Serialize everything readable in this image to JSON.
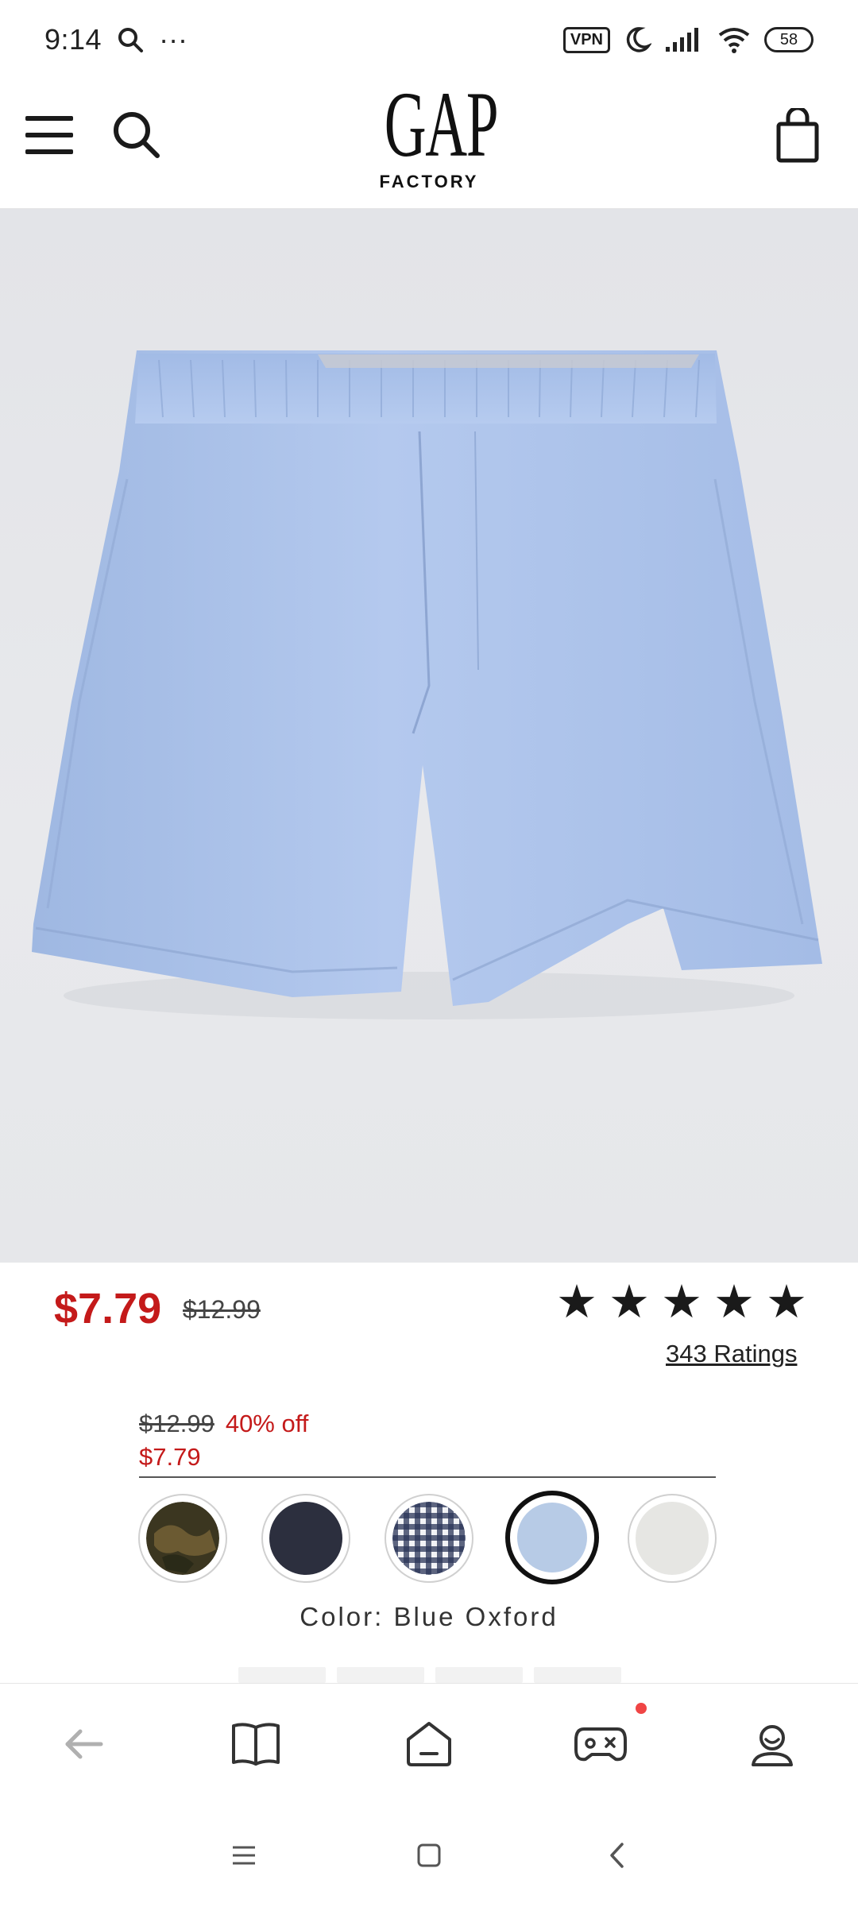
{
  "status_bar": {
    "time": "9:14",
    "more": "···",
    "vpn": "VPN",
    "battery": "58"
  },
  "header": {
    "logo_main": "GAP",
    "logo_sub": "FACTORY"
  },
  "product": {
    "price_sale": "$7.79",
    "price_original": "$12.99",
    "ratings_label": "343 Ratings",
    "rating_stars": 5,
    "swatch_price": {
      "original": "$12.99",
      "discount": "40% off",
      "sale": "$7.79"
    },
    "color_label": "Color: Blue Oxford",
    "swatches": [
      {
        "name": "camo",
        "color": "#4a4226"
      },
      {
        "name": "navy",
        "color": "#2c2f3e"
      },
      {
        "name": "gingham",
        "color": "#3a4a6e"
      },
      {
        "name": "blue-oxford",
        "color": "#b7cbe6",
        "selected": true
      },
      {
        "name": "light-gray",
        "color": "#e6e6e3"
      }
    ]
  },
  "colors": {
    "sale_red": "#c41a1a",
    "text_dark": "#1a1a1a",
    "image_bg": "#e5e6e9",
    "shorts_blue": "#a9c0e8"
  }
}
